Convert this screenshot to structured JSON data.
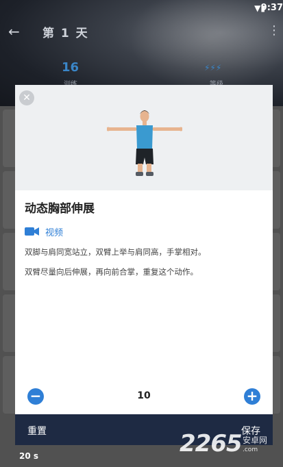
{
  "status_bar": {
    "time": "9:37"
  },
  "header": {
    "title": "第 1 天",
    "stat_count": "16",
    "stat_count_label": "训练",
    "stat_level_icon": "bolt-icons",
    "stat_level_label": "等级"
  },
  "background": {
    "footer_duration": "20 s"
  },
  "dialog": {
    "title": "动态胸部伸展",
    "video_label": "视频",
    "description": [
      "双脚与肩同宽站立，双臂上举与肩同高，手掌相对。",
      "双臂尽量向后伸展，再向前合掌，重复这个动作。"
    ],
    "stepper_value": "10",
    "reset_label": "重置",
    "save_label": "保存"
  },
  "watermark": {
    "main": "2265",
    "sub": "安卓网",
    "url": ".com"
  },
  "colors": {
    "accent": "#2f7fd6",
    "footer": "#1e2a43"
  }
}
